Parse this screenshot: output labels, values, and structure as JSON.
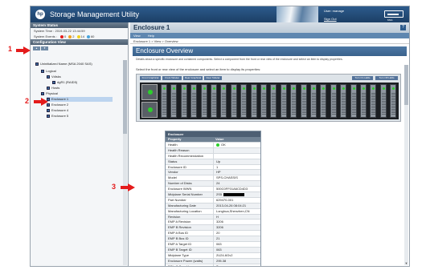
{
  "app": {
    "title": "Storage Management Utility",
    "logo": "hp"
  },
  "user": {
    "label": "User: manage",
    "signout": "Sign Out",
    "device_caption": "MSA"
  },
  "left": {
    "system_status": {
      "title": "System Status",
      "time_label": "System Time",
      "time_value": "2019-03-22 13:44:59",
      "events_label": "System Events",
      "events": [
        {
          "color": "#e41b1b",
          "count": "0"
        },
        {
          "color": "#f2a11d",
          "count": "2"
        },
        {
          "color": "#f2d21d",
          "count": "14"
        },
        {
          "color": "#48a4dc",
          "count": "60"
        }
      ]
    },
    "config_view": {
      "title": "Configuration View",
      "tools": [
        "▲",
        "▼"
      ],
      "tree": [
        {
          "label": "Uninitialized Name (MSA 2040 SAS)",
          "depth": 0
        },
        {
          "label": "Logical",
          "depth": 1
        },
        {
          "label": "Vdisks",
          "depth": 2
        },
        {
          "label": "dgR1 (RAID5)",
          "depth": 3
        },
        {
          "label": "Hosts",
          "depth": 2
        },
        {
          "label": "Physical",
          "depth": 1
        },
        {
          "label": "Enclosure 1",
          "depth": 2,
          "selected": true
        },
        {
          "label": "Enclosure 2",
          "depth": 2
        },
        {
          "label": "Enclosure 4",
          "depth": 2
        },
        {
          "label": "Enclosure 5",
          "depth": 2
        }
      ]
    }
  },
  "main": {
    "title": "Enclosure 1",
    "help": "?",
    "menu": [
      "View",
      "Help"
    ],
    "breadcrumb": "Enclosure 1 > View > Overview",
    "overview_title": "Enclosure Overview",
    "overview_desc": "Details about a specific enclosure and contained components. Select a component from the front or rear view of the enclosure and select an item to display properties.",
    "select_text": "Select the front or rear view of the enclosure and select an item to display its properties:",
    "view_buttons": [
      "Front Graphical",
      "Front Tabular",
      "Rear Graphical",
      "Rear Tabular"
    ],
    "led_buttons": [
      "Turn On LEDs",
      "Turn Off LEDs"
    ],
    "bay_count": 24,
    "properties": {
      "title": "Enclosure",
      "col_property": "Property",
      "col_value": "Value",
      "rows": [
        {
          "name": "Health",
          "value": "OK",
          "ok": true
        },
        {
          "name": "Health Reason",
          "value": ""
        },
        {
          "name": "Health Recommendation",
          "value": ""
        },
        {
          "name": "Status",
          "value": "Up"
        },
        {
          "name": "Enclosure ID",
          "value": "1"
        },
        {
          "name": "Vendor",
          "value": "HP"
        },
        {
          "name": "Model",
          "value": "SPS-CHASSIS"
        },
        {
          "name": "Number of Disks",
          "value": "24"
        },
        {
          "name": "Enclosure WWN",
          "value": "500C0FF01A6CD4D3"
        },
        {
          "name": "Midplane Serial Number",
          "value": "2S5",
          "redacted": true
        },
        {
          "name": "Part Number",
          "value": "629470-001"
        },
        {
          "name": "Manufacturing Date",
          "value": "2013-04-26 08:04:21"
        },
        {
          "name": "Manufacturing Location",
          "value": "Longhua,Shenzhen,CN"
        },
        {
          "name": "Revision",
          "value": "H"
        },
        {
          "name": "EMP A Revision",
          "value": "3206"
        },
        {
          "name": "EMP B Revision",
          "value": "3206"
        },
        {
          "name": "EMP A Bus ID",
          "value": "20"
        },
        {
          "name": "EMP B Bus ID",
          "value": "21"
        },
        {
          "name": "EMP A Target ID",
          "value": "063"
        },
        {
          "name": "EMP B Target ID",
          "value": "063"
        },
        {
          "name": "Midplane Type",
          "value": "2U24-6Gv2"
        },
        {
          "name": "Enclosure Power (watts)",
          "value": "295.38"
        },
        {
          "name": "PCIe 2-Capable",
          "value": "True"
        }
      ]
    }
  },
  "callouts": [
    "1",
    "2",
    "3"
  ]
}
